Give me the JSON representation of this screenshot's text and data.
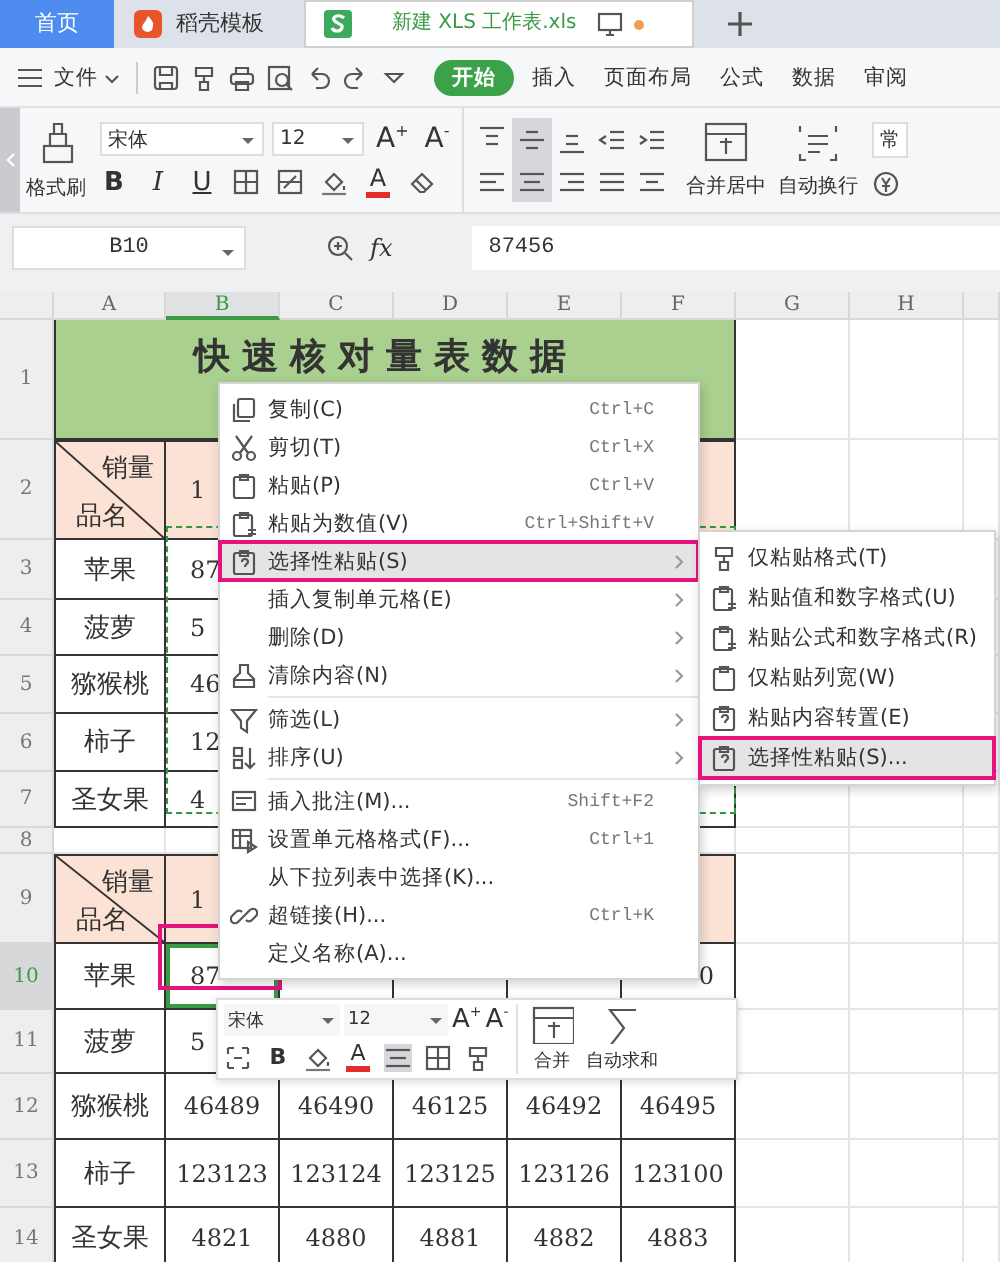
{
  "tabs": [
    {
      "label": "首页",
      "kind": "home",
      "selected": false
    },
    {
      "label": "稻壳模板",
      "kind": "docer",
      "selected": false
    },
    {
      "label": "新建 XLS 工作表.xls",
      "kind": "sheet",
      "selected": true
    }
  ],
  "menubar": {
    "file": "文件",
    "tabs": [
      {
        "label": "开始",
        "selected": true
      },
      {
        "label": "插入",
        "selected": false
      },
      {
        "label": "页面布局",
        "selected": false
      },
      {
        "label": "公式",
        "selected": false
      },
      {
        "label": "数据",
        "selected": false
      },
      {
        "label": "审阅",
        "selected": false
      }
    ]
  },
  "ribbon": {
    "format_painter": "格式刷",
    "font": "宋体",
    "size": "12",
    "grow": "A$^{+}$",
    "shrink": "A$^{-}$",
    "bold": "B",
    "italic": "I",
    "underline": "U",
    "font_color": "A",
    "align_buttons": [
      {
        "selected": false
      },
      {
        "selected": true
      },
      {
        "selected": false
      },
      {
        "selected": false
      },
      {
        "selected": false
      },
      {
        "selected": false
      },
      {
        "selected": true
      },
      {
        "selected": false
      },
      {
        "selected": false
      },
      {
        "selected": false
      }
    ],
    "merge": "合并居中",
    "wrap": "自动换行",
    "number_format": "常"
  },
  "formula_bar": {
    "cell": "B10",
    "fx": "fx",
    "value": "87456"
  },
  "sheet": {
    "columns": [
      {
        "label": "A",
        "selected": false
      },
      {
        "label": "B",
        "selected": true
      },
      {
        "label": "C",
        "selected": false
      },
      {
        "label": "D",
        "selected": false
      },
      {
        "label": "E",
        "selected": false
      },
      {
        "label": "F",
        "selected": false
      },
      {
        "label": "G",
        "selected": false
      },
      {
        "label": "H",
        "selected": false
      }
    ],
    "rows": [
      {
        "header": "1",
        "selected": false,
        "cells": [
          {
            "kind": "title_lead"
          },
          {
            "kind": "title",
            "text": "快速核对量表数据"
          }
        ]
      },
      {
        "header": "2",
        "selected": false,
        "cells": [
          {
            "kind": "diag",
            "top": "销量",
            "bottom": "品名"
          },
          {
            "kind": "head_clip",
            "text": "1"
          },
          {
            "kind": "head"
          },
          {
            "kind": "head"
          },
          {
            "kind": "head"
          },
          {
            "kind": "head"
          }
        ]
      },
      {
        "header": "3",
        "selected": false,
        "cells": [
          {
            "kind": "body",
            "text": "苹果"
          },
          {
            "kind": "clip",
            "text": "87"
          },
          {
            "kind": "body"
          },
          {
            "kind": "body"
          },
          {
            "kind": "body"
          },
          {
            "kind": "body"
          }
        ]
      },
      {
        "header": "4",
        "selected": false,
        "cells": [
          {
            "kind": "body",
            "text": "菠萝"
          },
          {
            "kind": "clip",
            "text": "5"
          },
          {
            "kind": "body"
          },
          {
            "kind": "body"
          },
          {
            "kind": "body"
          },
          {
            "kind": "body"
          }
        ]
      },
      {
        "header": "5",
        "selected": false,
        "cells": [
          {
            "kind": "body",
            "text": "猕猴桃"
          },
          {
            "kind": "clip",
            "text": "46"
          },
          {
            "kind": "body"
          },
          {
            "kind": "body"
          },
          {
            "kind": "body"
          },
          {
            "kind": "body"
          }
        ]
      },
      {
        "header": "6",
        "selected": false,
        "cells": [
          {
            "kind": "body",
            "text": "柿子"
          },
          {
            "kind": "clip",
            "text": "12"
          },
          {
            "kind": "body"
          },
          {
            "kind": "body"
          },
          {
            "kind": "body"
          },
          {
            "kind": "body"
          }
        ]
      },
      {
        "header": "7",
        "selected": false,
        "cells": [
          {
            "kind": "body",
            "text": "圣女果"
          },
          {
            "kind": "clip",
            "text": "4"
          },
          {
            "kind": "body"
          },
          {
            "kind": "body"
          },
          {
            "kind": "body"
          },
          {
            "kind": "body"
          }
        ]
      },
      {
        "header": "8",
        "selected": false,
        "cells": []
      },
      {
        "header": "9",
        "selected": false,
        "cells": [
          {
            "kind": "diag",
            "top": "销量",
            "bottom": "品名"
          },
          {
            "kind": "head_clip",
            "text": "1"
          },
          {
            "kind": "head"
          },
          {
            "kind": "head"
          },
          {
            "kind": "head"
          },
          {
            "kind": "head"
          }
        ]
      },
      {
        "header": "10",
        "selected": true,
        "cells": [
          {
            "kind": "body",
            "text": "苹果"
          },
          {
            "kind": "clip",
            "text": "87",
            "active": true
          },
          {
            "kind": "body"
          },
          {
            "kind": "body"
          },
          {
            "kind": "body"
          },
          {
            "kind": "clip_end",
            "text": "0"
          }
        ]
      },
      {
        "header": "11",
        "selected": false,
        "cells": [
          {
            "kind": "body",
            "text": "菠萝"
          },
          {
            "kind": "clip",
            "text": "5"
          },
          {
            "kind": "body"
          },
          {
            "kind": "body"
          },
          {
            "kind": "body"
          },
          {
            "kind": "body"
          }
        ]
      },
      {
        "header": "12",
        "selected": false,
        "cells": [
          {
            "kind": "body",
            "text": "猕猴桃"
          },
          {
            "kind": "body",
            "text": "46489"
          },
          {
            "kind": "body",
            "text": "46490"
          },
          {
            "kind": "body",
            "text": "46125"
          },
          {
            "kind": "body",
            "text": "46492"
          },
          {
            "kind": "body",
            "text": "46495"
          }
        ]
      },
      {
        "header": "13",
        "selected": false,
        "cells": [
          {
            "kind": "body",
            "text": "柿子"
          },
          {
            "kind": "body",
            "text": "123123"
          },
          {
            "kind": "body",
            "text": "123124"
          },
          {
            "kind": "body",
            "text": "123125"
          },
          {
            "kind": "body",
            "text": "123126"
          },
          {
            "kind": "body",
            "text": "123100"
          }
        ]
      },
      {
        "header": "14",
        "selected": false,
        "cells": [
          {
            "kind": "body",
            "text": "圣女果"
          },
          {
            "kind": "body",
            "text": "4821"
          },
          {
            "kind": "body",
            "text": "4880"
          },
          {
            "kind": "body",
            "text": "4881"
          },
          {
            "kind": "body",
            "text": "4882"
          },
          {
            "kind": "body",
            "text": "4883"
          }
        ]
      }
    ]
  },
  "context_menu": {
    "items": [
      {
        "label": "复制(C)",
        "shortcut": "Ctrl+C",
        "submenu": false,
        "selected": false
      },
      {
        "label": "剪切(T)",
        "shortcut": "Ctrl+X",
        "submenu": false,
        "selected": false
      },
      {
        "label": "粘贴(P)",
        "shortcut": "Ctrl+V",
        "submenu": false,
        "selected": false
      },
      {
        "label": "粘贴为数值(V)",
        "shortcut": "Ctrl+Shift+V",
        "submenu": false,
        "selected": false
      },
      {
        "label": "选择性粘贴(S)",
        "submenu": true,
        "selected": true
      },
      {
        "label": "插入复制单元格(E)",
        "submenu": true,
        "selected": false
      },
      {
        "label": "删除(D)",
        "submenu": true,
        "selected": false
      },
      {
        "label": "清除内容(N)",
        "submenu": true,
        "selected": false
      },
      {
        "kind": "separator"
      },
      {
        "label": "筛选(L)",
        "submenu": true,
        "selected": false
      },
      {
        "label": "排序(U)",
        "submenu": true,
        "selected": false
      },
      {
        "kind": "separator"
      },
      {
        "label": "插入批注(M)...",
        "shortcut": "Shift+F2",
        "submenu": false,
        "selected": false
      },
      {
        "label": "设置单元格格式(F)...",
        "shortcut": "Ctrl+1",
        "submenu": false,
        "selected": false
      },
      {
        "label": "从下拉列表中选择(K)...",
        "submenu": false,
        "selected": false
      },
      {
        "label": "超链接(H)...",
        "shortcut": "Ctrl+K",
        "submenu": false,
        "selected": false
      },
      {
        "label": "定义名称(A)...",
        "submenu": false,
        "selected": false
      }
    ]
  },
  "submenu": {
    "items": [
      {
        "label": "仅粘贴格式(T)",
        "selected": false
      },
      {
        "label": "粘贴值和数字格式(U)",
        "selected": false
      },
      {
        "label": "粘贴公式和数字格式(R)",
        "selected": false
      },
      {
        "label": "仅粘贴列宽(W)",
        "selected": false
      },
      {
        "label": "粘贴内容转置(E)",
        "selected": false
      },
      {
        "label": "选择性粘贴(S)...",
        "selected": true
      }
    ]
  },
  "mini_toolbar": {
    "font": "宋体",
    "size": "12",
    "grow": "A$^{+}$",
    "shrink": "A$^{-}$",
    "bold": "B",
    "font_color": "A",
    "align_selected": true,
    "merge": "合并",
    "sum": "自动求和"
  }
}
